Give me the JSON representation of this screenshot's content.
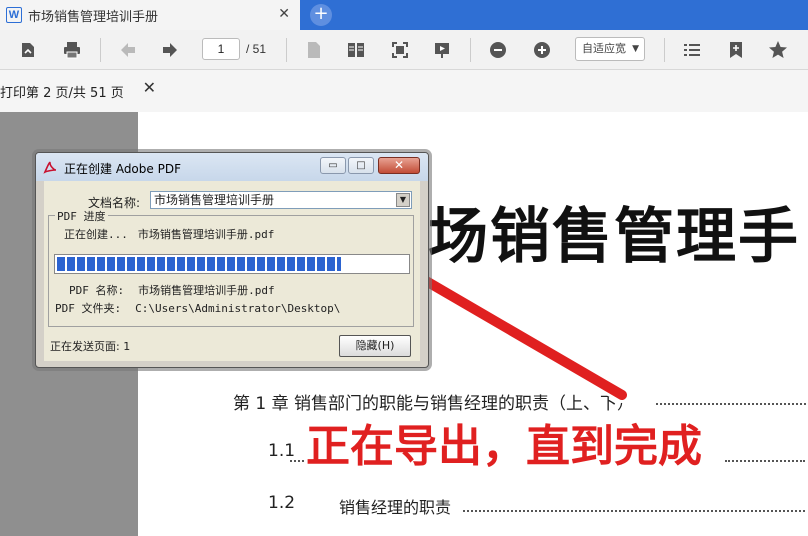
{
  "tab": {
    "icon_letter": "W",
    "title": "市场销售管理培训手册",
    "close": "✕",
    "new_tab": "+"
  },
  "toolbar": {
    "current_page": "1",
    "total_pages": "/ 51",
    "zoom_value": "自适应宽",
    "icons": [
      "export-icon",
      "print-icon",
      "back-icon",
      "forward-icon",
      "single-page-icon",
      "two-page-icon",
      "fit-icon",
      "slideshow-icon",
      "zoom-out-icon",
      "zoom-in-icon",
      "toc-icon",
      "bookmark-icon",
      "star-icon"
    ]
  },
  "print_panel": {
    "title": "打印第 2 页/共 51 页",
    "close": "✕"
  },
  "document": {
    "big_title": "场销售管理手",
    "toc": [
      {
        "text": "第 1 章  销售部门的职能与销售经理的职责（上、下）"
      },
      {
        "num": "1.1",
        "text": ""
      },
      {
        "num": "1.2",
        "text": "销售经理的职责"
      }
    ]
  },
  "dialog": {
    "title": "正在创建 Adobe PDF",
    "min_btn": "▭",
    "max_btn": "□",
    "close_btn": "✕",
    "doc_name_label": "文档名称:",
    "doc_name_value": "市场销售管理培训手册",
    "dropdown_glyph": "▼",
    "progress_group_label": "PDF 进度",
    "creating_label": "正在创建...",
    "creating_name": "市场销售管理培训手册.pdf",
    "progress_fraction": 0.81,
    "pdf_name_label": "PDF 名称:",
    "pdf_name_value": "市场销售管理培训手册.pdf",
    "pdf_folder_label": "PDF 文件夹:",
    "pdf_folder_value": "C:\\Users\\Administrator\\Desktop\\",
    "status_text": "正在发送页面: 1",
    "hide_button": "隐藏(H)"
  },
  "annotation": {
    "caption": "正在导出，直到完成",
    "color": "#e02020"
  }
}
